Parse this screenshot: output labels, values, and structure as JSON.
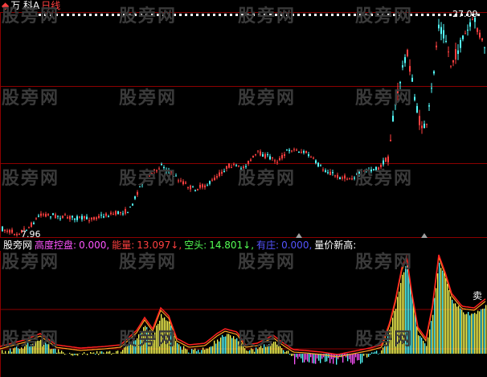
{
  "title_bar": {
    "icon_text": "◆",
    "stock_name": "万 科A",
    "period": "日线"
  },
  "price_chart": {
    "high_label": "27.09",
    "low_label": "7.96"
  },
  "indicator_header": {
    "source": "股旁网",
    "gaodu_label": "高度控盘:",
    "gaodu_value": "0.000,",
    "nengliang_label": "能量:",
    "nengliang_value": "13.097↓,",
    "kongtou_label": "空头:",
    "kongtou_value": "14.801↓,",
    "youzhuang_label": "有庄:",
    "youzhuang_value": "0.000,",
    "xingao_label": "量价新高:"
  },
  "indicator_annotation": "卖",
  "watermark": "股旁网",
  "colors": {
    "background": "#000000",
    "grid": "#8b0000",
    "candle_up": "#ff4040",
    "candle_down": "#54ffff",
    "bar_yellow": "#ffff54",
    "bar_cyan": "#54ffff",
    "bar_magenta": "#ff54ff",
    "line_red": "#ff2020",
    "line_orange": "#ffa020",
    "title_name": "#ffffff",
    "title_period": "#ff4040",
    "gaodu": "#ff54ff",
    "nengliang": "#ff4040",
    "kongtou": "#54ff54",
    "youzhuang": "#5454ff",
    "xingao": "#ffffff"
  }
}
